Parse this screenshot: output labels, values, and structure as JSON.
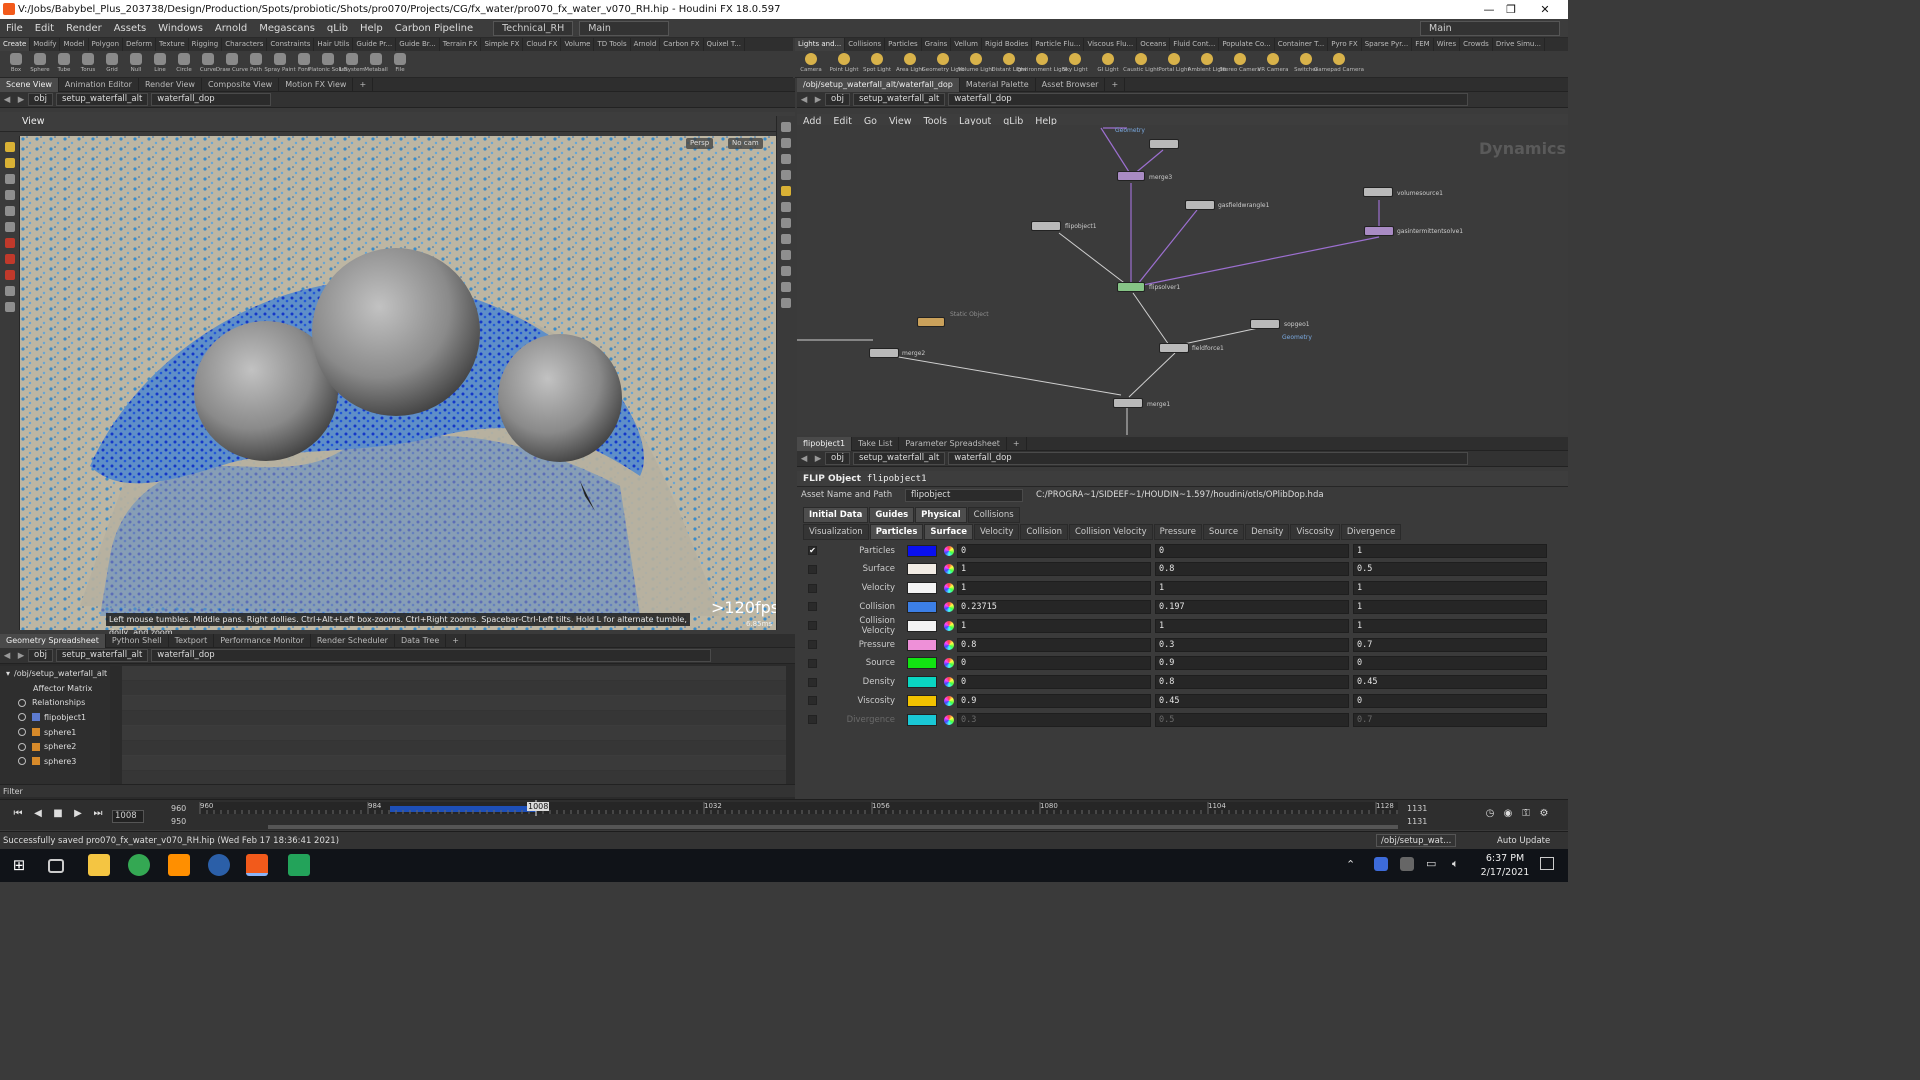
{
  "window": {
    "title": "V:/Jobs/Babybel_Plus_203738/Design/Production/Spots/probiotic/Shots/pro070/Projects/CG/fx_water/pro070_fx_water_v070_RH.hip - Houdini FX 18.0.597",
    "minimize": "—",
    "maximize": "❐",
    "close": "✕"
  },
  "menu": {
    "items": [
      "File",
      "Edit",
      "Render",
      "Assets",
      "Windows",
      "Arnold",
      "Megascans",
      "qLib",
      "Help",
      "Carbon Pipeline"
    ],
    "desktop": "Technical_RH",
    "layout": "Main",
    "right_desktop": "Main"
  },
  "shelf_left": {
    "tabs": [
      "Create",
      "Modify",
      "Model",
      "Polygon",
      "Deform",
      "Texture",
      "Rigging",
      "Characters",
      "Constraints",
      "Hair Utils",
      "Guide Pr...",
      "Guide Br...",
      "Terrain FX",
      "Simple FX",
      "Cloud FX",
      "Volume",
      "TD Tools",
      "Arnold",
      "Carbon FX",
      "Quixel T..."
    ],
    "tools": [
      "Box",
      "Sphere",
      "Tube",
      "Torus",
      "Grid",
      "Null",
      "Line",
      "Circle",
      "Curve",
      "Draw Curve",
      "Path",
      "Spray Paint",
      "Font",
      "Platonic Solids",
      "L-System",
      "Metaball",
      "File"
    ]
  },
  "shelf_right": {
    "tabs": [
      "Lights and...",
      "Collisions",
      "Particles",
      "Grains",
      "Vellum",
      "Rigid Bodies",
      "Particle Flu...",
      "Viscous Flu...",
      "Oceans",
      "Fluid Cont...",
      "Populate Co...",
      "Container T...",
      "Pyro FX",
      "Sparse Pyr...",
      "FEM",
      "Wires",
      "Crowds",
      "Drive Simu..."
    ],
    "tools": [
      "Camera",
      "Point Light",
      "Spot Light",
      "Area Light",
      "Geometry Light",
      "Volume Light",
      "Distant Light",
      "Environment Light",
      "Sky Light",
      "GI Light",
      "Caustic Light",
      "Portal Light",
      "Ambient Light",
      "Stereo Camera",
      "VR Camera",
      "Switcher",
      "Gamepad Camera"
    ]
  },
  "scene_tabs": [
    "Scene View",
    "Animation Editor",
    "Render View",
    "Composite View",
    "Motion FX View"
  ],
  "path": {
    "root": "obj",
    "net": "setup_waterfall_alt",
    "node": "waterfall_dop"
  },
  "viewport": {
    "title": "View",
    "persp": "Persp",
    "cam": "No cam",
    "hint": "Left mouse tumbles. Middle pans. Right dollies. Ctrl+Alt+Left box-zooms. Ctrl+Right zooms. Spacebar-Ctrl-Left tilts. Hold L for alternate tumble, dolly, and zoom.",
    "fps": ">120fps",
    "ms": "6.85ms"
  },
  "network": {
    "tabs": [
      "/obj/setup_waterfall_alt/waterfall_dop",
      "Material Palette",
      "Asset Browser"
    ],
    "menu": [
      "Add",
      "Edit",
      "Go",
      "View",
      "Tools",
      "Layout",
      "qLib",
      "Help"
    ],
    "context": "Dynamics",
    "nodes": [
      {
        "name": "merge3",
        "sub": ""
      },
      {
        "name": "gasfieldwrangle1",
        "sub": ""
      },
      {
        "name": "volumesource1",
        "sub": ""
      },
      {
        "name": "gasintermittentsolve1",
        "sub": ""
      },
      {
        "name": "flipobject1",
        "sub": ""
      },
      {
        "name": "flipsolver1",
        "sub": ""
      },
      {
        "name": "staticobject_waterfall",
        "sub": "Static Object"
      },
      {
        "name": "sopgeo1",
        "sub": "Geometry"
      },
      {
        "name": "merge2",
        "sub": ""
      },
      {
        "name": "fieldforce1",
        "sub": ""
      },
      {
        "name": "merge1",
        "sub": ""
      },
      {
        "name": "",
        "sub": "Geometry"
      }
    ]
  },
  "bottom_tabs": [
    "Geometry Spreadsheet",
    "Python Shell",
    "Textport",
    "Performance Monitor",
    "Render Scheduler",
    "Data Tree"
  ],
  "tree": {
    "root": "/obj/setup_waterfall_alt",
    "items": [
      "Affector Matrix",
      "Relationships",
      "flipobject1",
      "sphere1",
      "sphere2",
      "sphere3"
    ]
  },
  "filter": "Filter",
  "parm": {
    "tabs": [
      "flipobject1",
      "Take List",
      "Parameter Spreadsheet"
    ],
    "type": "FLIP Object",
    "name": "flipobject1",
    "asset_label": "Asset Name and Path",
    "asset": "flipobject",
    "asset_path": "C:/PROGRA~1/SIDEEF~1/HOUDIN~1.597/houdini/otls/OPlibDop.hda",
    "tabs1": [
      "Initial Data",
      "Guides",
      "Physical",
      "Collisions"
    ],
    "tabs2": [
      "Visualization",
      "Particles",
      "Surface",
      "Velocity",
      "Collision",
      "Collision Velocity",
      "Pressure",
      "Source",
      "Density",
      "Viscosity",
      "Divergence"
    ],
    "rows": [
      {
        "label": "Particles",
        "color": "#0a10f0",
        "v": [
          "0",
          "0",
          "1"
        ],
        "checked": "✔"
      },
      {
        "label": "Surface",
        "color": "#f2ece4",
        "v": [
          "1",
          "0.8",
          "0.5"
        ],
        "checked": ""
      },
      {
        "label": "Velocity",
        "color": "#f4f4f4",
        "v": [
          "1",
          "1",
          "1"
        ],
        "checked": ""
      },
      {
        "label": "Collision",
        "color": "#3c7fe6",
        "v": [
          "0.23715",
          "0.197",
          "1"
        ],
        "checked": ""
      },
      {
        "label": "Collision Velocity",
        "color": "#f4f4f4",
        "v": [
          "1",
          "1",
          "1"
        ],
        "checked": ""
      },
      {
        "label": "Pressure",
        "color": "#ee90d8",
        "v": [
          "0.8",
          "0.3",
          "0.7"
        ],
        "checked": ""
      },
      {
        "label": "Source",
        "color": "#12e312",
        "v": [
          "0",
          "0.9",
          "0"
        ],
        "checked": ""
      },
      {
        "label": "Density",
        "color": "#0ad6c2",
        "v": [
          "0",
          "0.8",
          "0.45"
        ],
        "checked": ""
      },
      {
        "label": "Viscosity",
        "color": "#f2c200",
        "v": [
          "0.9",
          "0.45",
          "0"
        ],
        "checked": ""
      },
      {
        "label": "Divergence",
        "color": "#1ac8d6",
        "v": [
          "0.3",
          "0.5",
          "0.7"
        ],
        "checked": ""
      }
    ]
  },
  "timeline": {
    "frame": "1008",
    "start": "960",
    "start2": "950",
    "end": "1131",
    "end2": "1131",
    "ticks": [
      "960",
      "984",
      "1008",
      "1032",
      "1056",
      "1080",
      "1104",
      "1128"
    ]
  },
  "status": {
    "message": "Successfully saved pro070_fx_water_v070_RH.hip (Wed Feb 17 18:36:41 2021)",
    "net_path": "/obj/setup_wat...",
    "auto": "Auto Update"
  },
  "taskbar": {
    "time": "6:37 PM",
    "date": "2/17/2021"
  }
}
